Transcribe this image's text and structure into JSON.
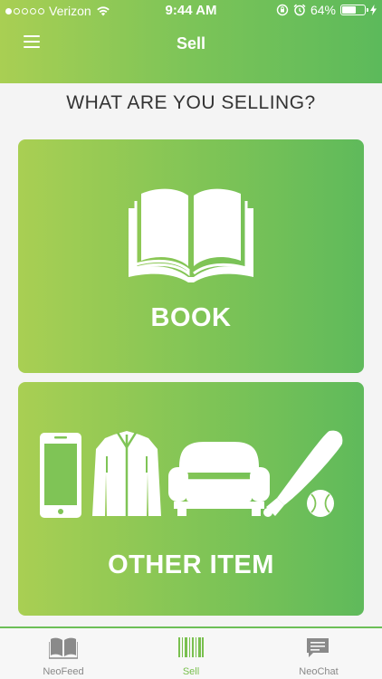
{
  "status_bar": {
    "carrier": "Verizon",
    "time": "9:44 AM",
    "battery_percent": "64%",
    "battery_level": 0.64,
    "signal_bars_filled": 1,
    "signal_bars_total": 5
  },
  "nav": {
    "title": "Sell"
  },
  "prompt": "WHAT ARE YOU SELLING?",
  "cards": {
    "book": {
      "label": "BOOK"
    },
    "other": {
      "label": "OTHER ITEM"
    }
  },
  "tabs": [
    {
      "label": "NeoFeed",
      "icon": "book-icon"
    },
    {
      "label": "Sell",
      "icon": "barcode-icon",
      "active": true
    },
    {
      "label": "NeoChat",
      "icon": "chat-icon"
    }
  ],
  "colors": {
    "gradient_start": "#a9cf53",
    "gradient_end": "#5cba5b",
    "active_tab": "#79c04f",
    "inactive_tab": "#888888"
  }
}
